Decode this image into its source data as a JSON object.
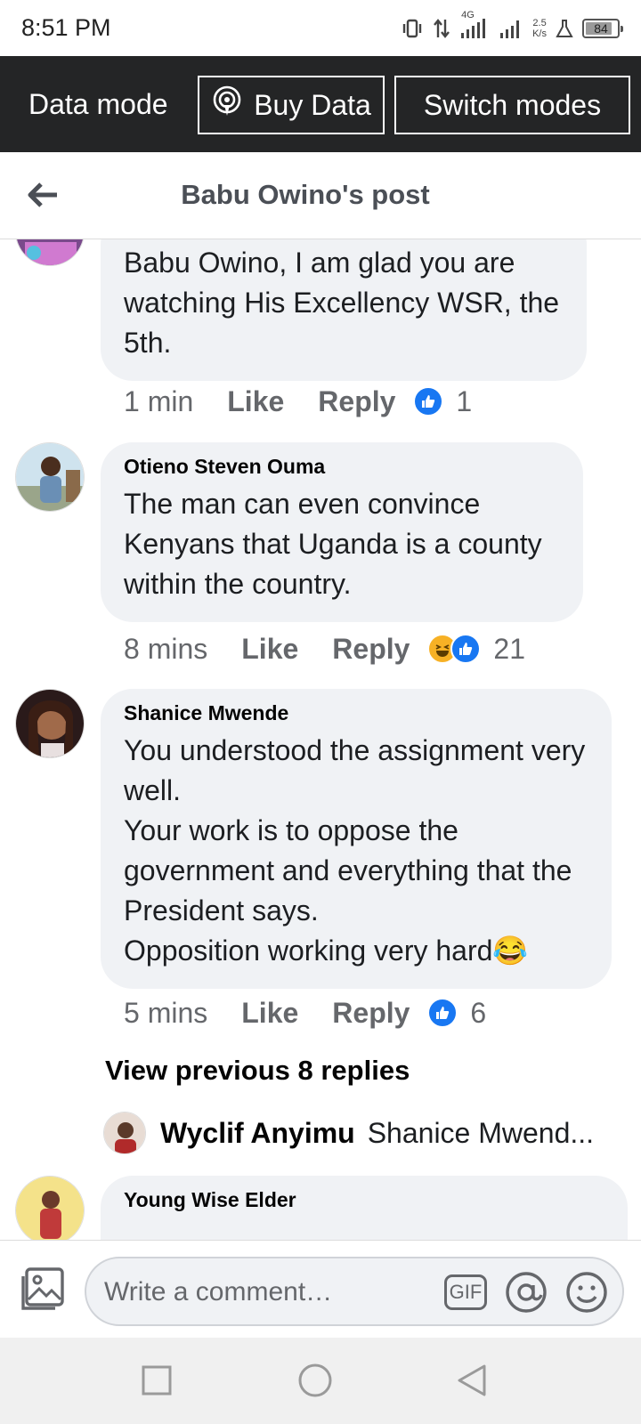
{
  "status_bar": {
    "time": "8:51 PM",
    "network_label": "4G",
    "speed_value": "2.5",
    "speed_unit": "K/s",
    "battery": "84"
  },
  "data_bar": {
    "label": "Data mode",
    "buy_data": "Buy Data",
    "switch_modes": "Switch modes"
  },
  "header": {
    "title": "Babu Owino's post"
  },
  "comments": [
    {
      "author": "",
      "text": "Babu Owino, I am glad you are watching His Excellency WSR, the 5th.",
      "time": "1 min",
      "like": "Like",
      "reply": "Reply",
      "reactions": [
        "like"
      ],
      "reaction_count": "1"
    },
    {
      "author": "Otieno Steven Ouma",
      "text": "The man can even convince Kenyans that Uganda is a county within the country.",
      "time": "8 mins",
      "like": "Like",
      "reply": "Reply",
      "reactions": [
        "haha",
        "like"
      ],
      "reaction_count": "21"
    },
    {
      "author": "Shanice Mwende",
      "text": "You understood the assignment very well.\nYour work is to oppose the government and everything that the President says.\nOpposition working very hard😂",
      "time": "5 mins",
      "like": "Like",
      "reply": "Reply",
      "reactions": [
        "like"
      ],
      "reaction_count": "6"
    },
    {
      "author": "Young Wise Elder"
    }
  ],
  "view_previous": "View previous 8 replies",
  "reply_preview": {
    "author": "Wyclif Anyimu",
    "text": "Shanice Mwend..."
  },
  "comment_bar": {
    "placeholder": "Write a comment…",
    "gif_label": "GIF"
  },
  "colors": {
    "data_bar_bg": "#242526",
    "bubble_bg": "#f0f2f5",
    "like_blue": "#1877f2",
    "haha_yellow": "#f7b125"
  }
}
